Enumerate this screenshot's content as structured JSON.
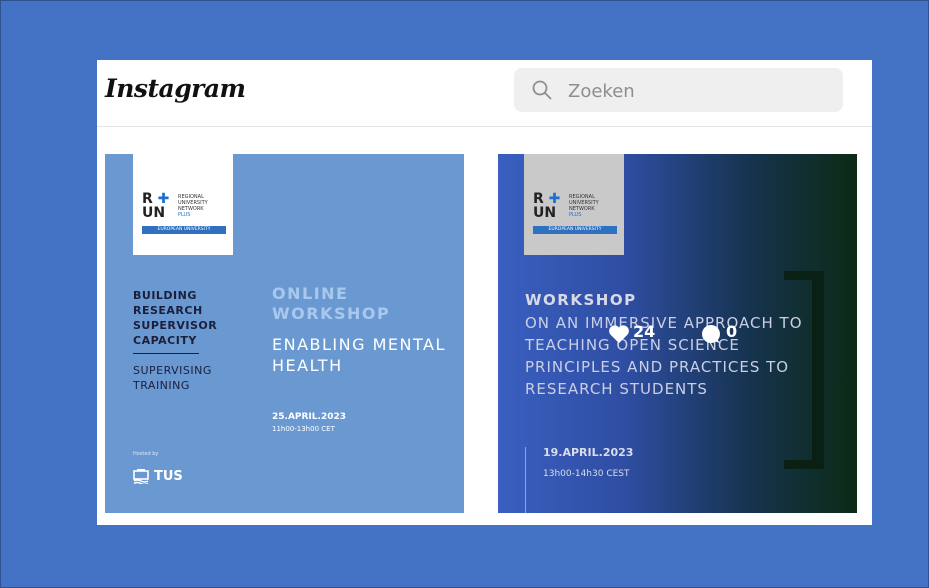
{
  "header": {
    "logo": "Instagram",
    "search_placeholder": "Zoeken"
  },
  "posts": [
    {
      "brand": {
        "r": "R",
        "un": "UN",
        "name": "REGIONAL\nUNIVERSITY\nNETWORK",
        "plus": "PLUS",
        "eu": "EUROPEAN UNIVERSITY"
      },
      "left_title": "BUILDING RESEARCH SUPERVISOR CAPACITY",
      "left_sub": "SUPERVISING TRAINING",
      "online": "ONLINE WORKSHOP",
      "topic": "ENABLING MENTAL HEALTH",
      "date": "25.APRIL.2023",
      "time": "11h00-13h00 CET",
      "hosted": "Hosted by",
      "host": "TUS"
    },
    {
      "brand": {
        "r": "R",
        "un": "UN",
        "name": "REGIONAL\nUNIVERSITY\nNETWORK",
        "plus": "PLUS",
        "eu": "EUROPEAN UNIVERSITY"
      },
      "workshop": "WORKSHOP",
      "body": "ON AN IMMERSIVE APPROACH TO TEACHING OPEN SCIENCE PRINCIPLES AND PRACTICES TO RESEARCH STUDENTS",
      "date": "19.APRIL.2023",
      "time": "13h00-14h30 CEST",
      "likes": "24",
      "comments": "0"
    }
  ],
  "colors": {
    "page_bg": "#4472c4",
    "post1_bg": "#6a99d2",
    "accent_blue": "#1e6fd0"
  }
}
